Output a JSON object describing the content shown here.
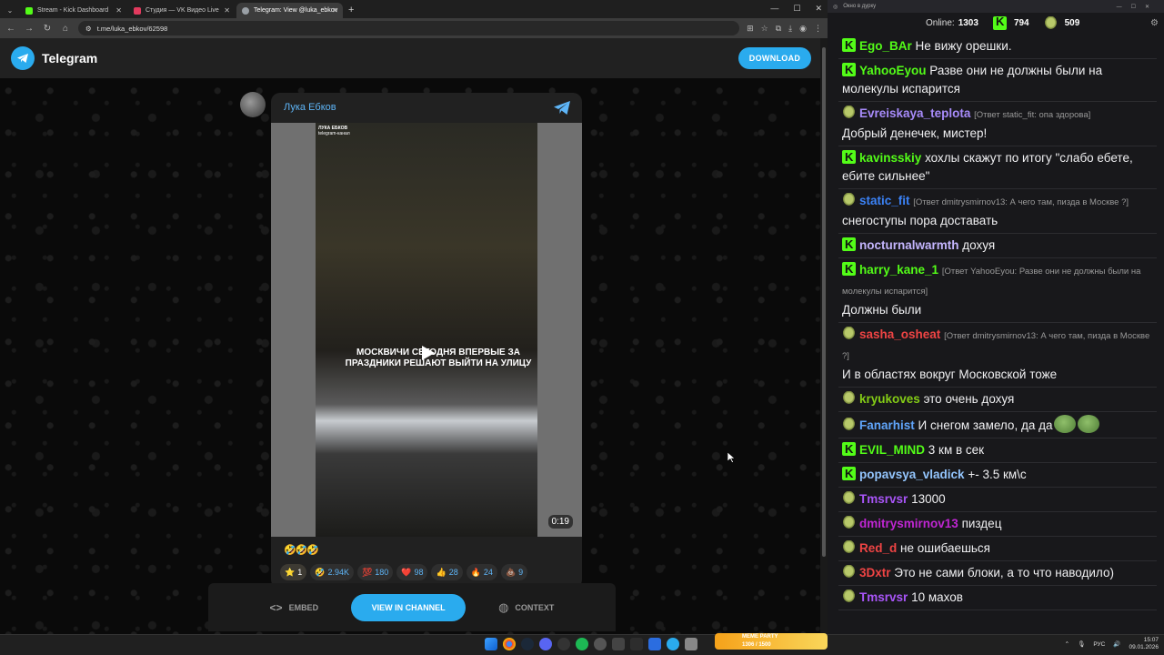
{
  "browser": {
    "tabs": [
      {
        "title": "Stream - Kick Dashboard",
        "color": "#53fc18"
      },
      {
        "title": "Студия — VK Видео Live",
        "color": "#e23a5e"
      },
      {
        "title": "Telegram: View @luka_ebkov",
        "color": "#9aa0a6"
      }
    ],
    "url": "t.me/luka_ebkov/62598"
  },
  "telegram": {
    "title": "Telegram",
    "download_label": "DOWNLOAD",
    "post": {
      "author": "Лука Ебков",
      "video_brand_line1": "ЛУКА ЕБКОВ",
      "video_brand_line2": "telegram-канал",
      "caption": "МОСКВИЧИ СЕГОДНЯ ВПЕРВЫЕ ЗА ПРАЗДНИКИ РЕШАЮТ ВЫЙТИ НА УЛИЦУ",
      "duration": "0:19",
      "emoji_text": "🤣🤣🤣",
      "reactions": [
        {
          "icon": "⭐",
          "count": "1",
          "mine": true
        },
        {
          "icon": "🤣",
          "count": "2.94K"
        },
        {
          "icon": "💯",
          "count": "180"
        },
        {
          "icon": "❤️",
          "count": "98"
        },
        {
          "icon": "👍",
          "count": "28"
        },
        {
          "icon": "🔥",
          "count": "24"
        },
        {
          "icon": "💩",
          "count": "9"
        }
      ]
    },
    "actions": {
      "embed": "EMBED",
      "view": "VIEW IN CHANNEL",
      "context": "CONTEXT"
    }
  },
  "chat": {
    "window_title": "Окно в дурку",
    "online_label": "Online:",
    "online": "1303",
    "kick_count": "794",
    "vk_count": "509",
    "messages": [
      {
        "user": "Ego_BAr",
        "color": "#53fc18",
        "badge": "kick",
        "text": "Не вижу орешки."
      },
      {
        "user": "YahooEyou",
        "color": "#53fc18",
        "badge": "kick",
        "text": "Разве они не должны были на молекулы испарится"
      },
      {
        "user": "Evreiskaya_teplota",
        "color": "#a78bfa",
        "badge": "frog",
        "reply": "[Ответ static_fit: опа здорова]",
        "text": "Добрый денечек, мистер!"
      },
      {
        "user": "kavinsskiy",
        "color": "#53fc18",
        "badge": "kick",
        "text": "хохлы скажут по итогу \"слабо ебете, ебите сильнее\""
      },
      {
        "user": "static_fit",
        "color": "#3b82f6",
        "badge": "frog",
        "reply": "[Ответ dmitrysmirnov13: А чего там, пизда в Москве ?]",
        "text": "снегоступы пора доставать"
      },
      {
        "user": "nocturnalwarmth",
        "color": "#c4b5fd",
        "badge": "kick",
        "text": "дохуя"
      },
      {
        "user": "harry_kane_1",
        "color": "#53fc18",
        "badge": "kick",
        "reply": "[Ответ YahooEyou: Разве они не должны были на молекулы испарится]",
        "text": "Должны были"
      },
      {
        "user": "sasha_osheat",
        "color": "#ef4444",
        "badge": "frog",
        "reply": "[Ответ dmitrysmirnov13: А чего там, пизда в Москве ?]",
        "text": "И в областях вокруг Московской тоже"
      },
      {
        "user": "kryukoves",
        "color": "#84cc16",
        "badge": "frog",
        "text": "это очень дохуя"
      },
      {
        "user": "Fanarhist",
        "color": "#60a5fa",
        "badge": "frog",
        "text": "И снегом замело, да да",
        "emotes": 2
      },
      {
        "user": "EVIL_MIND",
        "color": "#53fc18",
        "badge": "kick",
        "text": "3 км в сек"
      },
      {
        "user": "popavsya_vladick",
        "color": "#93c5fd",
        "badge": "kick",
        "text": "+- 3.5 км\\с"
      },
      {
        "user": "Tmsrvsr",
        "color": "#a855f7",
        "badge": "frog",
        "text": "13000"
      },
      {
        "user": "dmitrysmirnov13",
        "color": "#c026d3",
        "badge": "frog",
        "text": "пиздец"
      },
      {
        "user": "Red_d",
        "color": "#ef4444",
        "badge": "frog",
        "text": "не ошибаешься"
      },
      {
        "user": "3Dxtr",
        "color": "#ef4444",
        "badge": "frog",
        "text": "Это не сами блоки, а то что наводило)"
      },
      {
        "user": "Tmsrvsr",
        "color": "#a855f7",
        "badge": "frog",
        "text": "10 махов"
      }
    ]
  },
  "taskbar": {
    "meme_title": "MEME PARTY",
    "meme_progress": "1306 / 1500",
    "lang": "РУС",
    "time": "15:07",
    "date": "09.01.2026"
  }
}
